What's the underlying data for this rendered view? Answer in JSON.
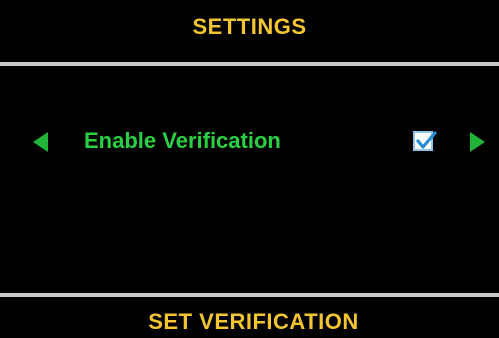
{
  "header": {
    "title": "SETTINGS"
  },
  "option": {
    "label": "Enable Verification",
    "checked": true,
    "prev_icon": "arrow-left-icon",
    "next_icon": "arrow-right-icon"
  },
  "footer": {
    "title": "SET VERIFICATION"
  },
  "colors": {
    "background": "#000000",
    "title": "#f3c531",
    "option_text": "#2ad043",
    "arrow": "#21b33a",
    "divider": "#c8c8c8",
    "checkmark": "#2a8fd0"
  }
}
